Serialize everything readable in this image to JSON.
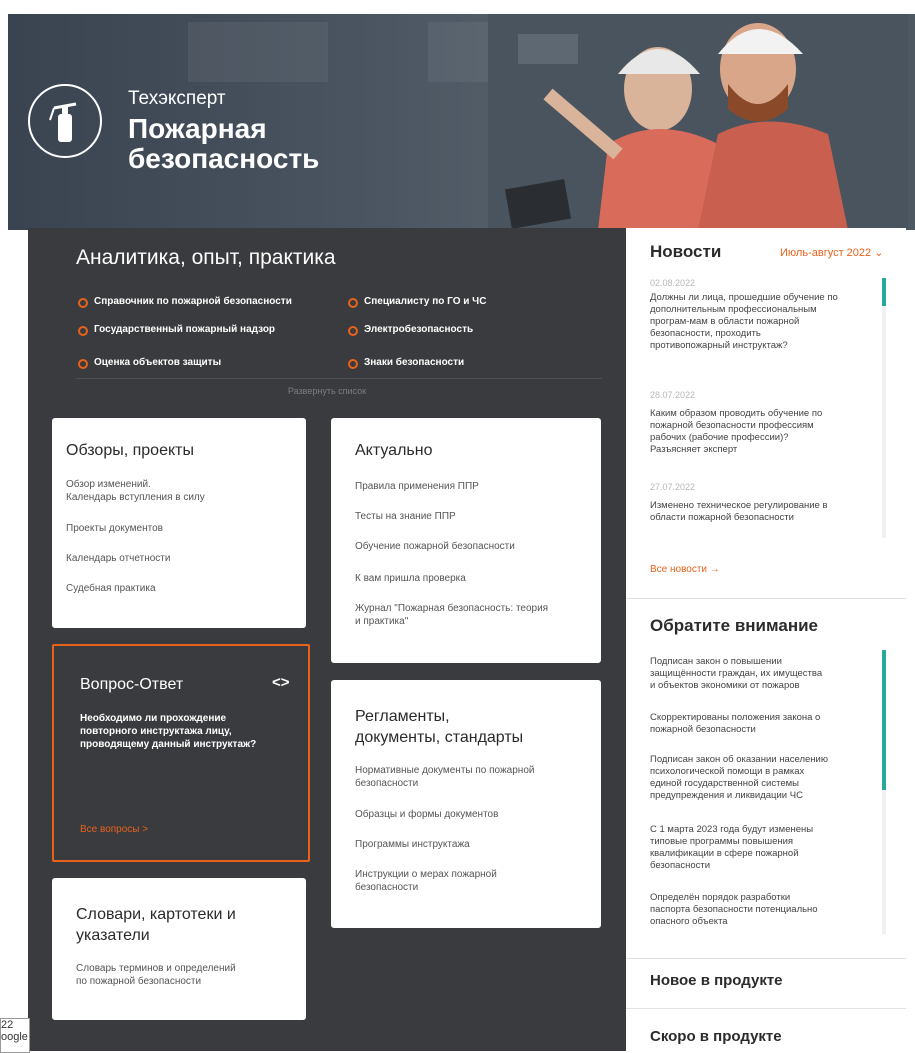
{
  "header": {
    "brand": "Техэксперт",
    "title_line1": "Пожарная",
    "title_line2": "безопасность"
  },
  "analytics": {
    "title": "Аналитика, опыт, практика",
    "links_col1": [
      "Справочник по пожарной безопасности",
      "Государственный пожарный надзор",
      "Оценка объектов защиты"
    ],
    "links_col2": [
      "Специалисту по ГО и ЧС",
      "Электробезопасность",
      "Знаки безопасности"
    ],
    "expand": "Развернуть список"
  },
  "reviews": {
    "title": "Обзоры, проекты",
    "items": [
      "Обзор изменений.",
      "Календарь вступления в силу",
      "Проекты документов",
      "Календарь отчетности",
      "Судебная практика"
    ]
  },
  "actual": {
    "title": "Актуально",
    "items": [
      "Правила применения ППР",
      "Тесты на знание ППР",
      "Обучение пожарной безопасности",
      "К вам пришла проверка",
      "Журнал \"Пожарная безопасность: теория",
      "и практика\""
    ]
  },
  "qa": {
    "title": "Вопрос-Ответ",
    "nav_icon": "<>",
    "question_l1": "Необходимо ли прохождение",
    "question_l2": "повторного инструктажа лицу,",
    "question_l3": "проводящему данный инструктаж?",
    "all_link": "Все вопросы",
    "arrow": ">"
  },
  "regulations": {
    "title_l1": "Регламенты,",
    "title_l2": "документы, стандарты",
    "items": [
      "Нормативные документы по пожарной",
      "безопасности",
      "Образцы и формы документов",
      "Программы инструктажа",
      "Инструкции о мерах пожарной",
      "безопасности"
    ]
  },
  "dictionaries": {
    "title_l1": "Словари, картотеки и",
    "title_l2": "указатели",
    "items": [
      "Словарь терминов и определений",
      "по пожарной безопасности"
    ]
  },
  "news": {
    "title": "Новости",
    "period": "Июль-август 2022",
    "entries": [
      {
        "date": "02.08.2022",
        "lines": [
          "Должны ли лица, прошедшие обучение по",
          "дополнительным профессиональным",
          "програм-мам в области пожарной",
          "безопасности, проходить",
          "противопожарный инструктаж?"
        ]
      },
      {
        "date": "28.07.2022",
        "lines": [
          "Каким образом проводить обучение по",
          "пожарной безопасности профессиям",
          "рабочих (рабочие профессии)?",
          "Разъясняет эксперт"
        ]
      },
      {
        "date": "27.07.2022",
        "lines": [
          "Изменено техническое регулирование в",
          "области пожарной безопасности"
        ]
      }
    ],
    "all_link": "Все новости →"
  },
  "attention": {
    "title": "Обратите внимание",
    "entries": [
      [
        "Подписан закон о повышении",
        "защищённости граждан, их имущества",
        "и объектов экономики от пожаров"
      ],
      [
        "Скорректированы положения закона о",
        "пожарной безопасности"
      ],
      [
        "Подписан закон об оказании населению",
        "психологической помощи в рамках",
        "единой государственной системы",
        "предупреждения и ликвидации ЧС"
      ],
      [
        "С 1 марта 2023 года будут изменены",
        "типовые программы повышения",
        "квалификации в сфере пожарной",
        "безопасности"
      ],
      [
        "Определён порядок разработки",
        "паспорта безопасности потенциально",
        "опасного объекта"
      ]
    ]
  },
  "new_in_product": "Новое в продукте",
  "soon_in_product": "Скоро в продукте",
  "corner": {
    "line1": "22",
    "line2": "oogle"
  },
  "colors": {
    "accent": "#e8621c",
    "dark": "#3a3b3e",
    "teal": "#29a89a"
  }
}
